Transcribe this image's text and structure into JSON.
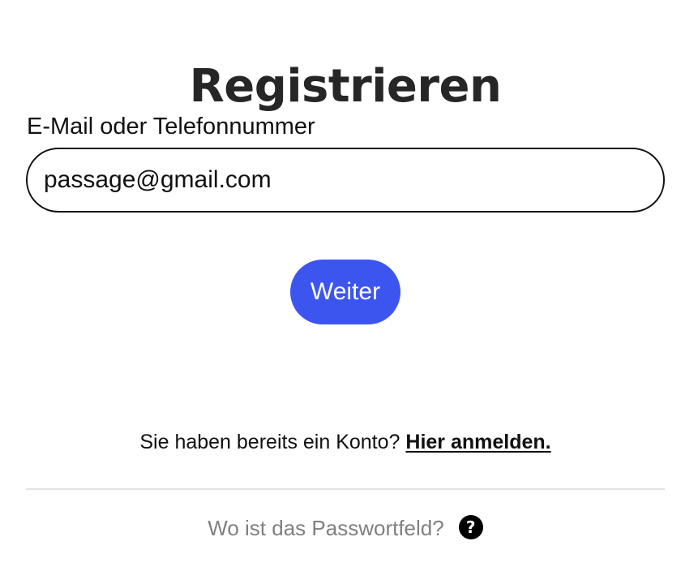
{
  "page": {
    "title": "Registrieren"
  },
  "form": {
    "email_label": "E-Mail oder Telefonnummer",
    "email_value": "passage@gmail.com",
    "continue_label": "Weiter"
  },
  "login_prompt": {
    "text": "Sie haben bereits ein Konto?",
    "link_label": "Hier anmelden."
  },
  "help": {
    "text": "Wo ist das Passwortfeld?",
    "icon": "question-circle-icon",
    "icon_glyph": "?"
  },
  "colors": {
    "accent": "#3d55ef",
    "text": "#111111",
    "muted": "#808080",
    "divider": "#e2e2e2"
  }
}
